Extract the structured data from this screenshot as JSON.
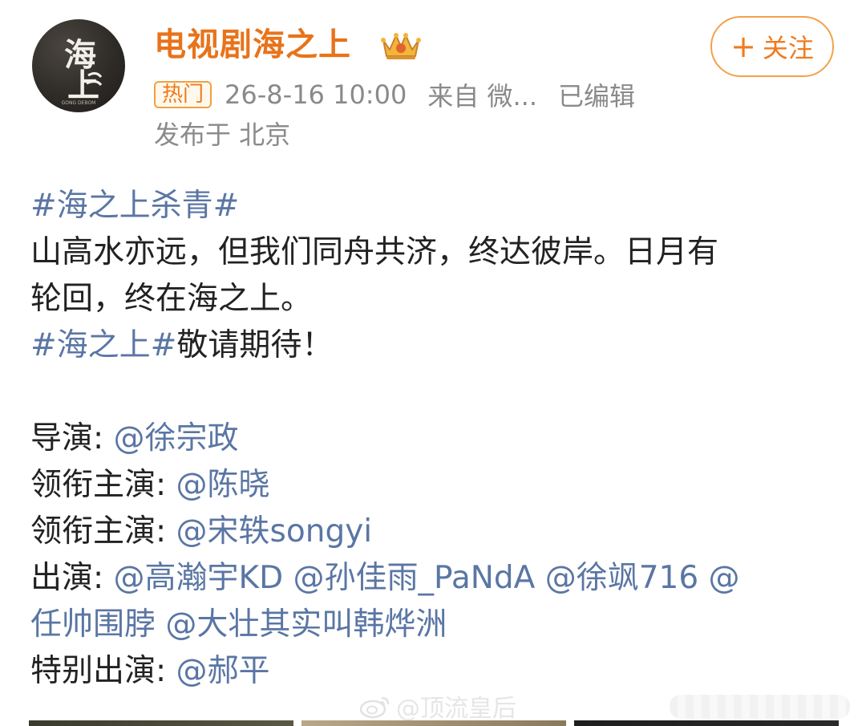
{
  "header": {
    "avatar_text_top": "海",
    "avatar_text_bottom": "上",
    "avatar_caption": "GONG DEBOM",
    "username": "电视剧海之上",
    "vip_icon": "crown-vip-icon",
    "follow_plus": "+",
    "follow_label": "关注",
    "hot_badge": "热门",
    "timestamp": "26-8-16 10:00",
    "source": "来自 微...",
    "edited": "已编辑",
    "location": "发布于 北京"
  },
  "post": {
    "line1_topic": "#海之上杀青#",
    "line2": "山高水亦远，但我们同舟共济，终达彼岸。日月有",
    "line3": "轮回，终在海之上。",
    "line4_topic": "#海之上#",
    "line4_text": "敬请期待！",
    "director_label": "导演: ",
    "director": "@徐宗政",
    "lead1_label": "领衔主演: ",
    "lead1": "@陈晓",
    "lead2_label": "领衔主演: ",
    "lead2": "@宋轶songyi",
    "cast_label": "出演: ",
    "cast_line1": "@高瀚宇KD @孙佳雨_PaNdA @徐飒716 @",
    "cast_line2": "任帅围脖 @大壮其实叫韩烨洲",
    "special_label": "特别出演: ",
    "special": "@郝平"
  },
  "watermark": {
    "icon": "weibo-icon",
    "text": "@顶流皇后"
  },
  "colors": {
    "username": "#e8731a",
    "link": "#5a76a4",
    "follow": "#f07b1e",
    "meta": "#8a8a8a"
  }
}
